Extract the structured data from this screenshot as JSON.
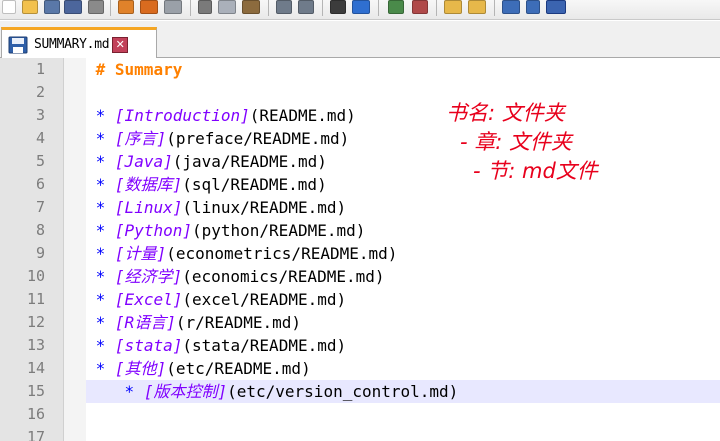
{
  "tab": {
    "label": "SUMMARY.md",
    "close_glyph": "✕"
  },
  "editor": {
    "lines": [
      {
        "num": "1",
        "heading": "# Summary"
      },
      {
        "num": "2"
      },
      {
        "num": "3",
        "bullet": "*",
        "link": "[Introduction]",
        "path": "(README.md)"
      },
      {
        "num": "4",
        "bullet": "*",
        "link": "[序言]",
        "path": "(preface/README.md)"
      },
      {
        "num": "5",
        "bullet": "*",
        "link": "[Java]",
        "path": "(java/README.md)"
      },
      {
        "num": "6",
        "bullet": "*",
        "link": "[数据库]",
        "path": "(sql/README.md)"
      },
      {
        "num": "7",
        "bullet": "*",
        "link": "[Linux]",
        "path": "(linux/README.md)"
      },
      {
        "num": "8",
        "bullet": "*",
        "link": "[Python]",
        "path": "(python/README.md)"
      },
      {
        "num": "9",
        "bullet": "*",
        "link": "[计量]",
        "path": "(econometrics/README.md)"
      },
      {
        "num": "10",
        "bullet": "*",
        "link": "[经济学]",
        "path": "(economics/README.md)"
      },
      {
        "num": "11",
        "bullet": "*",
        "link": "[Excel]",
        "path": "(excel/README.md)"
      },
      {
        "num": "12",
        "bullet": "*",
        "link": "[R语言]",
        "path": "(r/README.md)"
      },
      {
        "num": "13",
        "bullet": "*",
        "link": "[stata]",
        "path": "(stata/README.md)"
      },
      {
        "num": "14",
        "bullet": "*",
        "link": "[其他]",
        "path": "(etc/README.md)"
      },
      {
        "num": "15",
        "indent": "  ",
        "bullet": "*",
        "link": "[版本控制]",
        "path": "(etc/version_control.md)",
        "current": true
      },
      {
        "num": "16"
      },
      {
        "num": "17"
      }
    ]
  },
  "annotations": {
    "line1": "书名: 文件夹",
    "line2": "- 章: 文件夹",
    "line3": "- 节: md文件"
  },
  "colors": {
    "heading": "#ff8000",
    "bullet": "#0000ff",
    "link": "#8000ff",
    "annotation": "#e8001c",
    "current_line": "#e8e8ff"
  }
}
